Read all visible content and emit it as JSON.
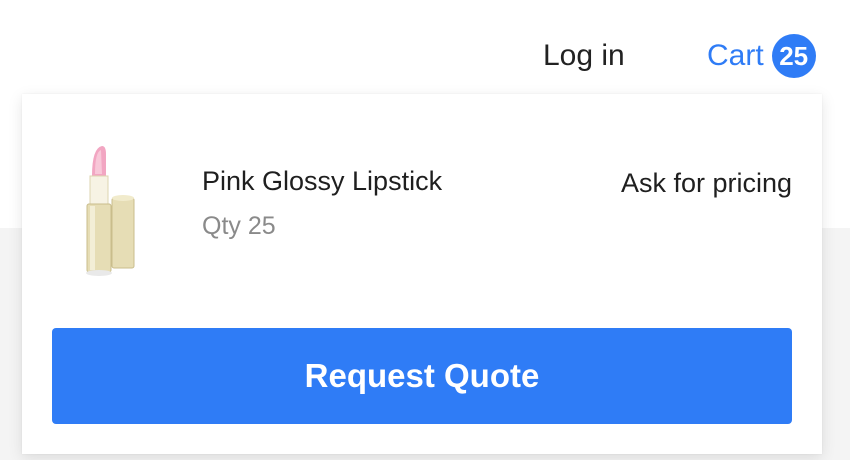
{
  "nav": {
    "login_label": "Log in",
    "cart_label": "Cart",
    "cart_count": "25"
  },
  "cart_dropdown": {
    "items": [
      {
        "name": "Pink Glossy Lipstick",
        "quantity": "Qty 25",
        "price": "Ask for pricing",
        "image_icon": "lipstick-product-image"
      }
    ],
    "action_label": "Request Quote"
  },
  "colors": {
    "accent": "#2f7cf6",
    "text": "#1f1f1f",
    "muted_text": "#8a8a8a"
  }
}
